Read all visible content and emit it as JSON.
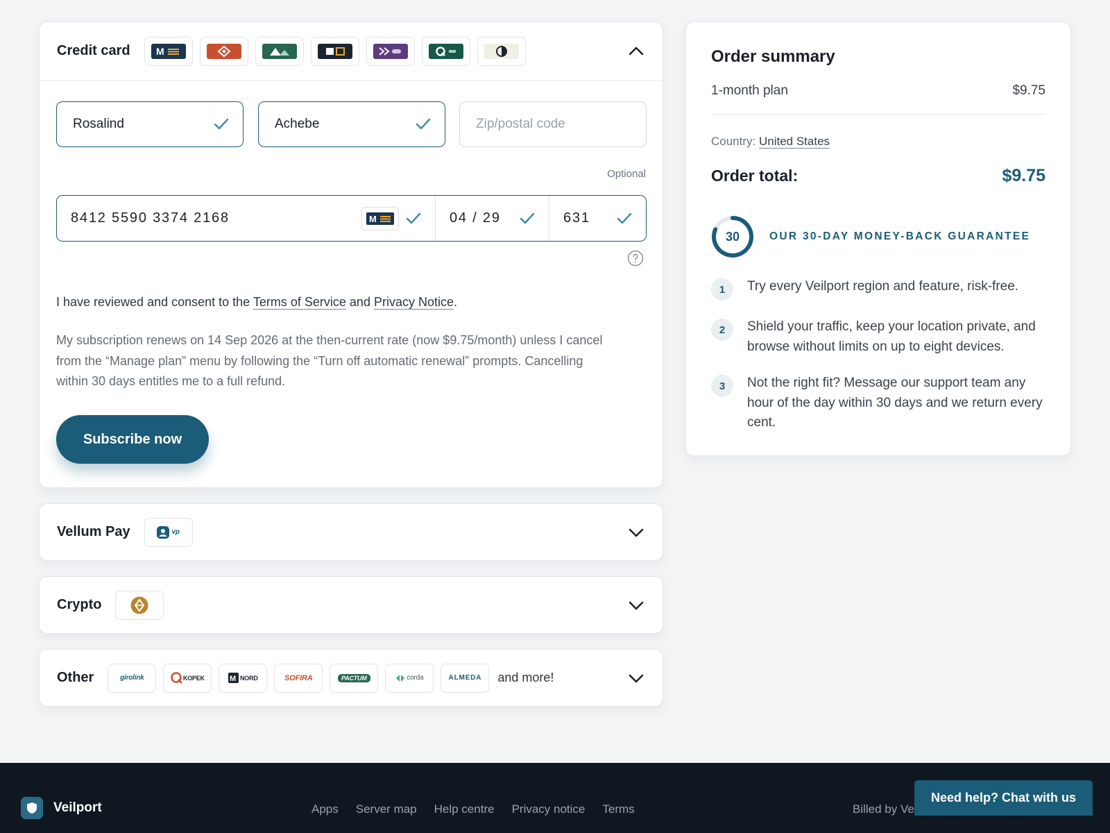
{
  "payment": {
    "credit_card": {
      "title": "Credit card",
      "first_name": "Rosalind",
      "last_name": "Achebe",
      "zip_placeholder": "Zip/postal code",
      "optional_label": "Optional",
      "card_number": "8412 5590 3374 2168",
      "expiry": "04 / 29",
      "cvc": "631"
    },
    "consent": {
      "prefix": "I have reviewed and consent to the ",
      "terms_link": "Terms of Service",
      "and": " and ",
      "privacy_link": "Privacy Notice",
      "suffix": "."
    },
    "renewal_text": "My subscription renews on 14 Sep 2026 at the then-current rate (now $9.75/month) unless I cancel from the “Manage plan” menu by following the “Turn off automatic renewal” prompts. Cancelling within 30 days entitles me to a full refund.",
    "subscribe_label": "Subscribe now",
    "vellum_pay": {
      "title": "Vellum Pay",
      "logo_text": "vp"
    },
    "crypto": {
      "title": "Crypto"
    },
    "other": {
      "title": "Other",
      "logos": [
        "girolink",
        "KOPEK",
        "NORD",
        "SOFIRA",
        "PACTUM",
        "corda",
        "ALMEDA"
      ],
      "more_label": "and more!"
    }
  },
  "summary": {
    "title": "Order summary",
    "plan_label": "1-month plan",
    "plan_price": "$9.75",
    "country_label": "Country:",
    "country_value": "United States",
    "total_label": "Order total:",
    "total_value": "$9.75",
    "guarantee_days": "30",
    "guarantee_text": "OUR 30-DAY MONEY-BACK GUARANTEE",
    "steps": [
      {
        "num": "1",
        "text": "Try every Veilport region and feature, risk-free."
      },
      {
        "num": "2",
        "text": "Shield your traffic, keep your location private, and browse without limits on up to eight devices."
      },
      {
        "num": "3",
        "text": "Not the right fit? Message our support team any hour of the day within 30 days and we return every cent."
      }
    ]
  },
  "footer": {
    "brand": "Veilport",
    "links": [
      "Apps",
      "Server map",
      "Help centre",
      "Privacy notice",
      "Terms"
    ],
    "billed_text": "Billed by Ve"
  },
  "chat_label": "Need help? Chat with us",
  "colors": {
    "accent": "#1b5c78",
    "footer_bg": "#0f1820",
    "check": "#3f8aa6"
  }
}
